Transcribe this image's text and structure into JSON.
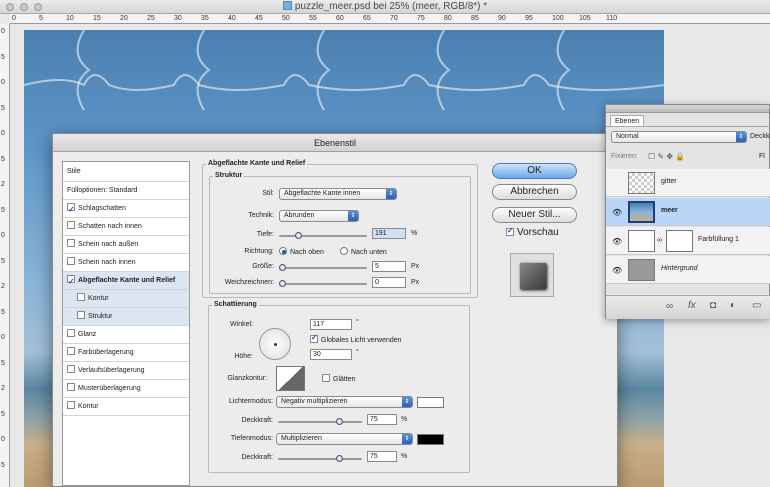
{
  "window": {
    "title": "puzzle_meer.psd bei 25% (meer, RGB/8*) *"
  },
  "ruler": {
    "h": [
      "0",
      "5",
      "10",
      "15",
      "20",
      "25",
      "30",
      "35",
      "40",
      "45",
      "50",
      "55",
      "60",
      "65",
      "70",
      "75",
      "80",
      "85",
      "90",
      "95",
      "100",
      "105",
      "110"
    ],
    "v": [
      "0",
      "5",
      "0",
      "5",
      "0",
      "5",
      "2",
      "5",
      "0",
      "5",
      "2",
      "5",
      "0",
      "5",
      "2",
      "5",
      "0",
      "5"
    ]
  },
  "dialog": {
    "title": "Ebenenstil",
    "styles": {
      "header": "Stile",
      "options": "Fülloptionen: Standard",
      "items": [
        {
          "label": "Schlagschatten",
          "checked": true
        },
        {
          "label": "Schatten nach innen",
          "checked": false
        },
        {
          "label": "Schein nach außen",
          "checked": false
        },
        {
          "label": "Schein nach innen",
          "checked": false
        },
        {
          "label": "Abgeflachte Kante und Relief",
          "checked": true
        },
        {
          "label": "Kontur",
          "checked": false
        },
        {
          "label": "Struktur",
          "checked": false
        },
        {
          "label": "Glanz",
          "checked": false
        },
        {
          "label": "Farbüberlagerung",
          "checked": false
        },
        {
          "label": "Verlaufsüberlagerung",
          "checked": false
        },
        {
          "label": "Musterüberlagerung",
          "checked": false
        },
        {
          "label": "Kontur",
          "checked": false
        }
      ]
    },
    "bevel": {
      "title": "Abgeflachte Kante und Relief",
      "structure": "Struktur",
      "stil_label": "Stil:",
      "stil_value": "Abgeflachte Kante innen",
      "technik_label": "Technik:",
      "technik_value": "Abrunden",
      "tiefe_label": "Tiefe:",
      "tiefe_value": "191",
      "tiefe_unit": "%",
      "tiefe_level": 0.2,
      "richtung_label": "Richtung:",
      "dir_up": "Nach oben",
      "dir_down": "Nach unten",
      "groesse_label": "Größe:",
      "groesse_value": "5",
      "groesse_unit": "Px",
      "weich_label": "Weichzeichnen:",
      "weich_value": "0",
      "weich_unit": "Px"
    },
    "shading": {
      "title": "Schattierung",
      "winkel_label": "Winkel:",
      "winkel_value": "117",
      "deg": "°",
      "global_light": "Globales Licht verwenden",
      "hoehe_label": "Höhe:",
      "hoehe_value": "30",
      "glanzkontur_label": "Glanzkontur:",
      "glaetten": "Glätten",
      "lichter_label": "Lichtermodus:",
      "lichter_value": "Negativ multiplizieren",
      "lichter_color": "#ffffff",
      "deck1_label": "Deckkraft:",
      "deck1_value": "75",
      "pct": "%",
      "tiefen_label": "Tiefenmodus:",
      "tiefen_value": "Multiplizieren",
      "tiefen_color": "#000000",
      "deck2_label": "Deckkraft:",
      "deck2_value": "75",
      "opacity_level": 0.75
    },
    "buttons": {
      "ok": "OK",
      "cancel": "Abbrechen",
      "new_style": "Neuer Stil...",
      "preview": "Vorschau"
    }
  },
  "layers": {
    "tab": "Ebenen",
    "mode": "Normal",
    "deck": "Deckk",
    "fix": "Fixieren:",
    "fl": "Fl",
    "rows": [
      {
        "name": "gitter"
      },
      {
        "name": "meer"
      },
      {
        "name": "Farbfüllung 1"
      },
      {
        "name": "Hintergrund"
      }
    ],
    "footer": "fx"
  }
}
